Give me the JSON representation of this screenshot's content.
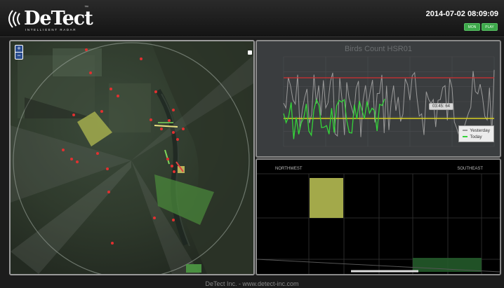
{
  "header": {
    "logo_text": "DeTect",
    "logo_tagline": "INTELLIGENT RADAR",
    "logo_tm": "™",
    "datetime": "2014-07-02 08:09:09",
    "buttons": [
      "MON",
      "PLAY"
    ]
  },
  "map": {
    "zoom_in": "+",
    "zoom_out": "−",
    "radar_range_rings": 1
  },
  "chart": {
    "title": "Birds Count HSR01",
    "tooltip": "03:45: 64",
    "chart_data": {
      "type": "line",
      "title": "Birds Count HSR01",
      "series": [
        {
          "name": "Yesterday",
          "color": "#aaaaaa"
        },
        {
          "name": "Today",
          "color": "#35d43a"
        }
      ],
      "thresholds": [
        {
          "color": "#d23030",
          "level": "upper"
        },
        {
          "color": "#d8d020",
          "level": "lower"
        }
      ],
      "grid": true,
      "legend": "bottom-right"
    }
  },
  "legend": {
    "yesterday": "Yesterday",
    "today": "Today",
    "yesterday_color": "#9a9a9a",
    "today_color": "#35d43a"
  },
  "radar_view": {
    "northwest": "NORTHWEST",
    "southeast": "SOUTHEAST"
  },
  "footer": {
    "text": "DeTect Inc. - www.detect-inc.com"
  }
}
